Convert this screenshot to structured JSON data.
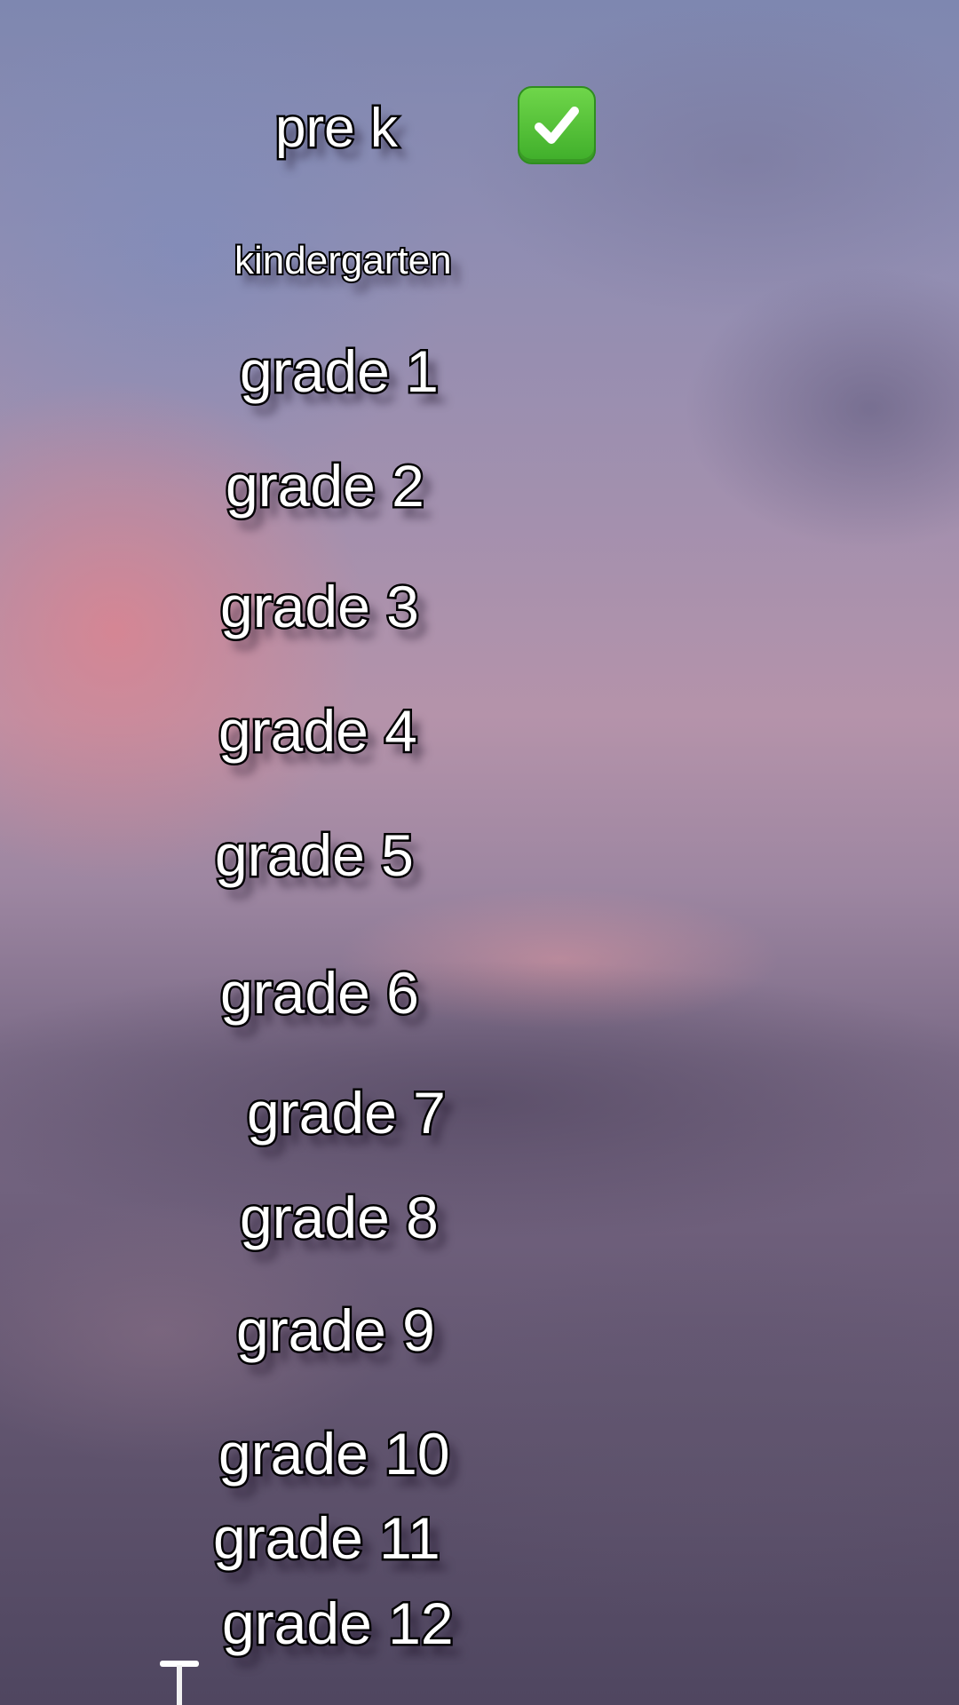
{
  "grades": {
    "pre_k": "pre k",
    "kindergarten": "kindergarten",
    "grade_1": "grade 1",
    "grade_2": "grade 2",
    "grade_3": "grade 3",
    "grade_4": "grade 4",
    "grade_5": "grade 5",
    "grade_6": "grade 6",
    "grade_7": "grade 7",
    "grade_8": "grade 8",
    "grade_9": "grade 9",
    "grade_10": "grade 10",
    "grade_11": "grade 11",
    "grade_12": "grade 12"
  },
  "status": {
    "completed_icon": "check-mark-button-icon",
    "completed_color": "#44b52c"
  },
  "colors": {
    "text_fill": "#ffffff",
    "text_outline": "#000000"
  }
}
